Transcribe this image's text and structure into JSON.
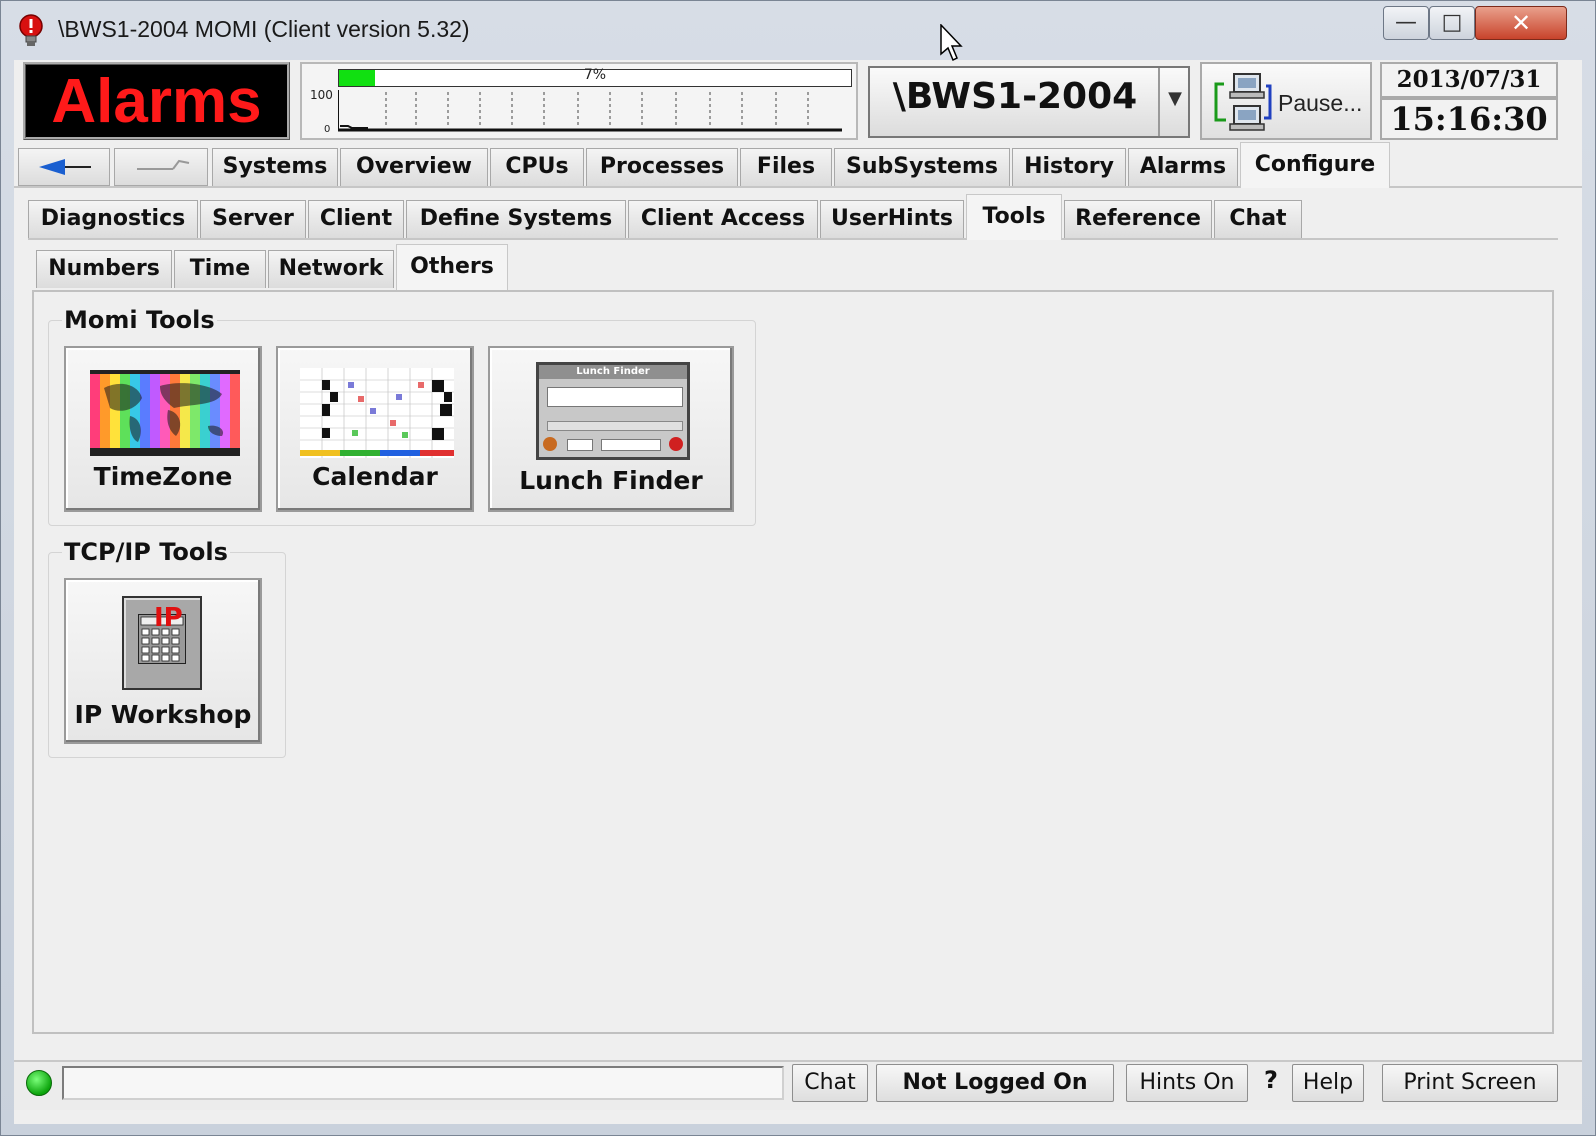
{
  "window": {
    "title": "\\BWS1-2004 MOMI (Client version 5.32)",
    "controls": {
      "minimize": "—",
      "maximize": "□",
      "close": "✕"
    }
  },
  "header": {
    "alarms_label": "Alarms",
    "cpu": {
      "percent_label": "7%",
      "value_percent": 7,
      "scale_max": "100",
      "scale_min": "0"
    },
    "system_name": "\\BWS1-2004",
    "pause_label": "Pause...",
    "date": "2013/07/31",
    "time": "15:16:30"
  },
  "main_tabs": [
    {
      "label": "Systems"
    },
    {
      "label": "Overview"
    },
    {
      "label": "CPUs"
    },
    {
      "label": "Processes"
    },
    {
      "label": "Files"
    },
    {
      "label": "SubSystems"
    },
    {
      "label": "History"
    },
    {
      "label": "Alarms"
    },
    {
      "label": "Configure",
      "active": true
    }
  ],
  "sub_tabs": [
    {
      "label": "Diagnostics"
    },
    {
      "label": "Server"
    },
    {
      "label": "Client"
    },
    {
      "label": "Define Systems"
    },
    {
      "label": "Client Access"
    },
    {
      "label": "UserHints"
    },
    {
      "label": "Tools",
      "active": true
    },
    {
      "label": "Reference"
    },
    {
      "label": "Chat"
    }
  ],
  "tool_tabs": [
    {
      "label": "Numbers"
    },
    {
      "label": "Time"
    },
    {
      "label": "Network"
    },
    {
      "label": "Others",
      "active": true
    }
  ],
  "groups": {
    "momi": {
      "title": "Momi Tools",
      "tools": [
        {
          "label": "TimeZone",
          "icon": "timezone-map-icon"
        },
        {
          "label": "Calendar",
          "icon": "calendar-grid-icon"
        },
        {
          "label": "Lunch Finder",
          "icon": "lunch-finder-window-icon"
        }
      ]
    },
    "tcpip": {
      "title": "TCP/IP Tools",
      "tools": [
        {
          "label": "IP Workshop",
          "icon": "ip-calculator-icon"
        }
      ]
    }
  },
  "lunch_finder_icon_title": "Lunch Finder",
  "ip_icon_text": "IP",
  "statusbar": {
    "chat": "Chat",
    "login": "Not Logged On",
    "hints": "Hints On",
    "question": "?",
    "help": "Help",
    "print": "Print Screen"
  },
  "colors": {
    "alarm_red": "#ff1a1a",
    "cpu_green": "#11e011",
    "status_green": "#0ca40c",
    "panel_bg": "#efefef"
  }
}
